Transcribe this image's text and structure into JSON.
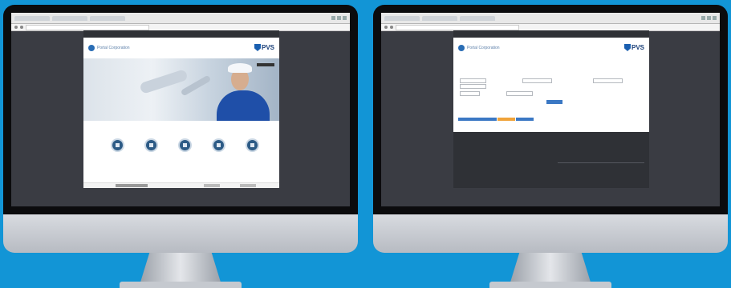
{
  "left_screen": {
    "browser": {
      "tabs": [
        "",
        "",
        ""
      ],
      "url": ""
    },
    "nav": {
      "items": [
        "",
        "",
        "",
        "",
        ""
      ],
      "login": ""
    },
    "brand": {
      "name": "Portal Corporation",
      "logo_text": "PVS"
    },
    "icons": [
      {
        "icon": "chat-icon",
        "label": ""
      },
      {
        "icon": "document-icon",
        "label": ""
      },
      {
        "icon": "folder-icon",
        "label": ""
      },
      {
        "icon": "calendar-icon",
        "label": ""
      },
      {
        "icon": "edit-icon",
        "label": ""
      }
    ]
  },
  "right_screen": {
    "browser": {
      "tabs": [
        "",
        "",
        ""
      ],
      "url": ""
    },
    "nav": {
      "items": [
        "",
        "",
        "",
        "",
        ""
      ],
      "login": ""
    },
    "brand": {
      "name": "Portal Corporation",
      "logo_text": "PVS"
    },
    "form": {
      "labels": [
        "",
        "",
        "",
        "",
        "",
        "",
        ""
      ],
      "selects": [
        "",
        "",
        "",
        "",
        ""
      ],
      "submit_label": ""
    },
    "tabs": [
      "",
      "",
      ""
    ],
    "footer": {
      "col1": [
        "",
        "",
        ""
      ],
      "col2": [
        "",
        "",
        "",
        "",
        ""
      ],
      "col3": [
        "",
        "",
        "",
        "",
        ""
      ],
      "copyright": ""
    }
  },
  "colors": {
    "background": "#1295d6",
    "nav_bar": "#2f3136",
    "accent_blue": "#3b78c4",
    "orange_tab": "#f0a33a"
  }
}
